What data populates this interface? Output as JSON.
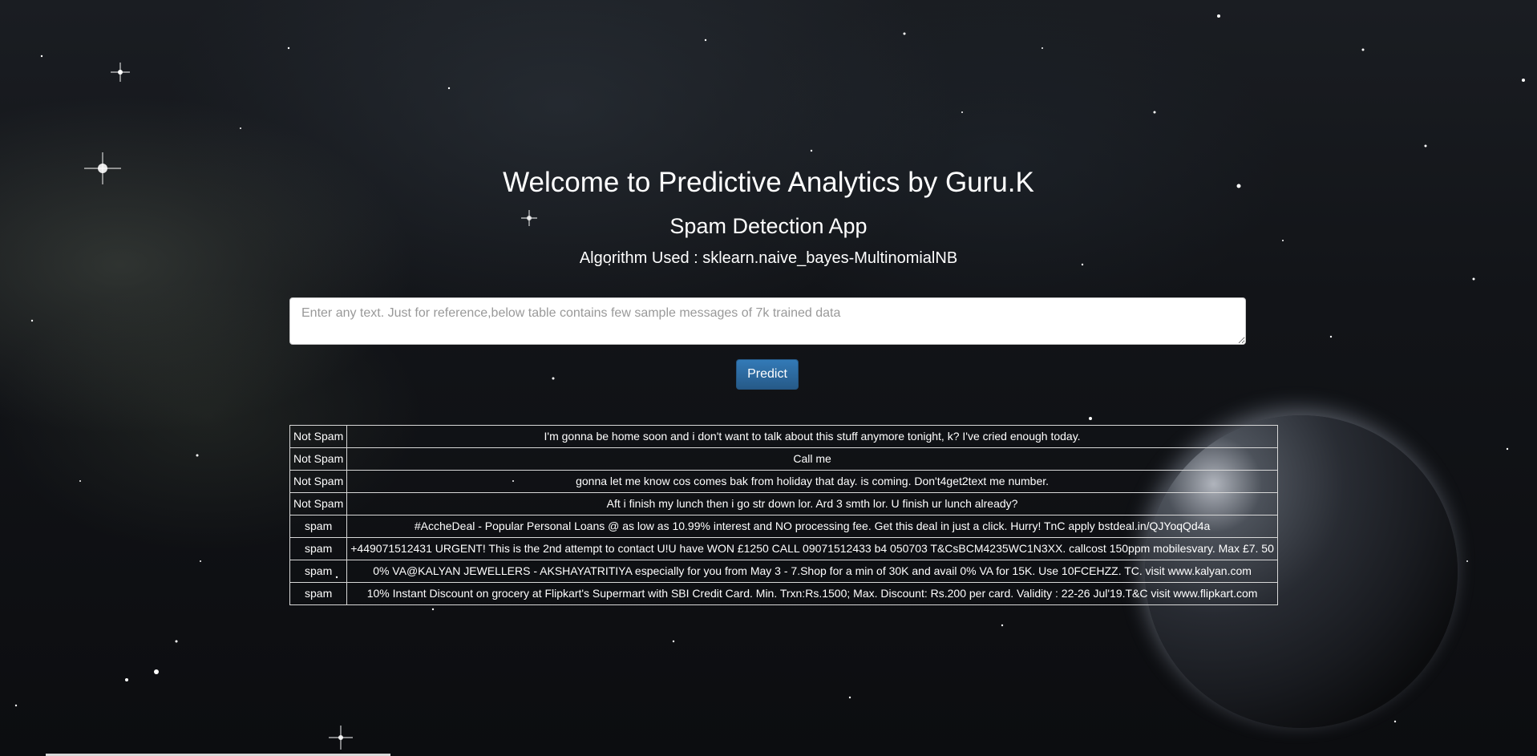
{
  "header": {
    "title": "Welcome to Predictive Analytics by Guru.K",
    "subtitle": "Spam Detection App",
    "algorithm": "Algorithm Used : sklearn.naive_bayes-MultinomialNB"
  },
  "form": {
    "message_placeholder": "Enter any text. Just for reference,below table contains few sample messages of 7k trained data",
    "message_value": "",
    "predict_label": "Predict"
  },
  "samples": [
    {
      "label": "Not Spam",
      "text": "I'm gonna be home soon and i don't want to talk about this stuff anymore tonight, k? I've cried enough today."
    },
    {
      "label": "Not Spam",
      "text": "Call me"
    },
    {
      "label": "Not Spam",
      "text": "gonna let me know cos comes bak from holiday that day. is coming. Don't4get2text me number."
    },
    {
      "label": "Not Spam",
      "text": "Aft i finish my lunch then i go str down lor. Ard 3 smth lor. U finish ur lunch already?"
    },
    {
      "label": "spam",
      "text": "#AccheDeal - Popular Personal Loans @ as low as 10.99% interest and NO processing fee. Get this deal in just a click. Hurry! TnC apply bstdeal.in/QJYoqQd4a"
    },
    {
      "label": "spam",
      "text": "+449071512431 URGENT! This is the 2nd attempt to contact U!U have WON £1250 CALL 09071512433 b4 050703 T&CsBCM4235WC1N3XX. callcost 150ppm mobilesvary. Max £7. 50"
    },
    {
      "label": "spam",
      "text": "0% VA@KALYAN JEWELLERS - AKSHAYATRITIYA especially for you from May 3 - 7.Shop for a min of 30K and avail 0% VA for 15K. Use 10FCEHZZ. TC. visit www.kalyan.com"
    },
    {
      "label": "spam",
      "text": "10% Instant Discount on grocery at Flipkart's Supermart with SBI Credit Card. Min. Trxn:Rs.1500; Max. Discount: Rs.200 per card. Validity : 22-26 Jul'19.T&C visit www.flipkart.com"
    }
  ],
  "colors": {
    "button": "#337ab7",
    "text": "#ffffff",
    "background": "#121418"
  }
}
